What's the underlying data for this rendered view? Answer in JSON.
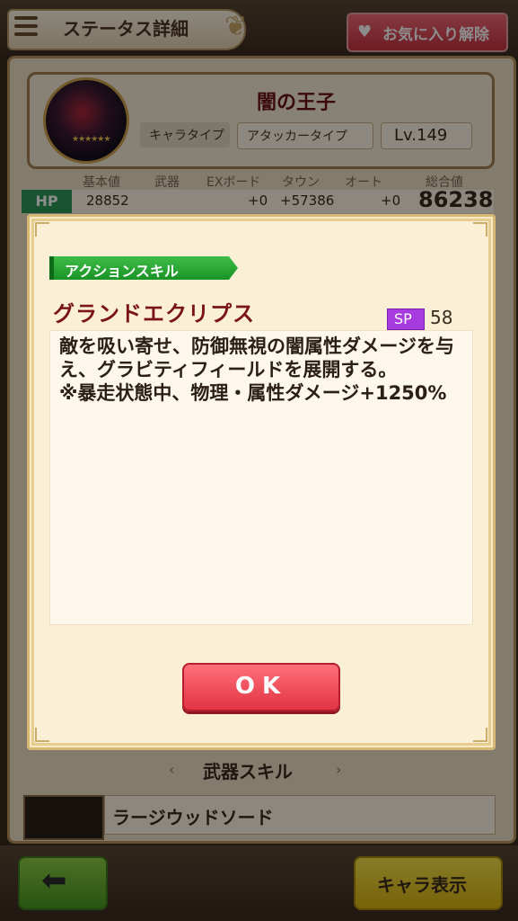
{
  "header": {
    "title": "ステータス詳細",
    "favorite_label": "お気に入り解除"
  },
  "character": {
    "name": "闇の王子",
    "type_label": "キャラタイプ",
    "type_value": "アタッカータイプ",
    "level": "Lv.149",
    "rarity_stars": "★★★★★★"
  },
  "stats": {
    "headers": [
      "基本値",
      "武器",
      "EXボード",
      "タウン",
      "オート",
      "総合値"
    ],
    "hp": {
      "label": "HP",
      "base": "28852",
      "exboard": "+0",
      "town": "+57386",
      "auto": "+0",
      "total": "86238"
    }
  },
  "skill_modal": {
    "tag": "アクションスキル",
    "name": "グランドエクリプス",
    "sp_label": "SP",
    "sp_value": "58",
    "description": "敵を吸い寄せ、防御無視の闇属性ダメージを与え、グラビティフィールドを展開する。\n※暴走状態中、物理・属性ダメージ+1250%",
    "ok_label": "OK"
  },
  "weapon_section": {
    "title": "武器スキル",
    "weapon_name": "ラージウッドソード"
  },
  "bottom": {
    "back_icon": "left-arrow-icon",
    "chara_display_label": "キャラ表示"
  }
}
